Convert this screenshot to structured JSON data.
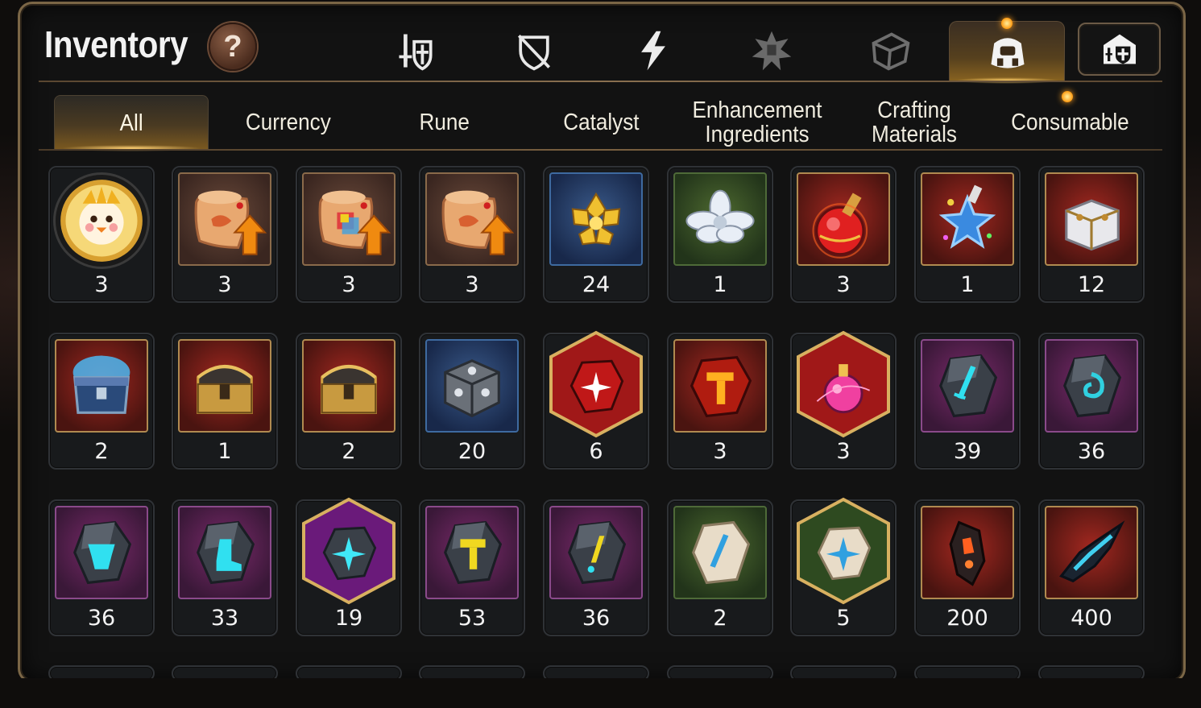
{
  "header": {
    "title": "Inventory",
    "help_label": "?"
  },
  "category_icons": [
    {
      "name": "equipment-icon",
      "active": false
    },
    {
      "name": "no-equip-icon",
      "active": false
    },
    {
      "name": "lightning-icon",
      "active": false
    },
    {
      "name": "artifact-icon",
      "active": false
    },
    {
      "name": "cube-icon",
      "active": false
    },
    {
      "name": "backpack-icon",
      "active": true
    },
    {
      "name": "guild-storage-icon",
      "active": false
    }
  ],
  "tabs": [
    {
      "label": "All",
      "active": true
    },
    {
      "label": "Currency",
      "active": false
    },
    {
      "label": "Rune",
      "active": false
    },
    {
      "label": "Catalyst",
      "active": false
    },
    {
      "label": "Enhancement Ingredients",
      "active": false
    },
    {
      "label": "Crafting Materials",
      "active": false
    },
    {
      "label": "Consumable",
      "active": false
    }
  ],
  "items": [
    {
      "count": "3",
      "icon": "mascot-coin-icon"
    },
    {
      "count": "3",
      "icon": "upgrade-scroll-icon"
    },
    {
      "count": "3",
      "icon": "rainbow-upgrade-scroll-icon"
    },
    {
      "count": "3",
      "icon": "upgrade-scroll-icon"
    },
    {
      "count": "24",
      "icon": "gold-crystal-icon"
    },
    {
      "count": "1",
      "icon": "silver-flower-icon"
    },
    {
      "count": "3",
      "icon": "red-potion-icon"
    },
    {
      "count": "1",
      "icon": "star-potion-icon"
    },
    {
      "count": "12",
      "icon": "silver-chest-icon"
    },
    {
      "count": "2",
      "icon": "blue-chest-icon"
    },
    {
      "count": "1",
      "icon": "gold-chest-icon"
    },
    {
      "count": "2",
      "icon": "gold-chest-icon"
    },
    {
      "count": "20",
      "icon": "steel-cube-icon"
    },
    {
      "count": "6",
      "icon": "red-star-stone-icon"
    },
    {
      "count": "3",
      "icon": "red-hammer-stone-icon"
    },
    {
      "count": "3",
      "icon": "pink-potion-icon"
    },
    {
      "count": "39",
      "icon": "sword-stone-icon"
    },
    {
      "count": "36",
      "icon": "swirl-stone-icon"
    },
    {
      "count": "36",
      "icon": "armor-stone-icon"
    },
    {
      "count": "33",
      "icon": "boot-stone-icon"
    },
    {
      "count": "19",
      "icon": "purple-star-stone-icon"
    },
    {
      "count": "53",
      "icon": "hammer-stone-icon"
    },
    {
      "count": "36",
      "icon": "exclaim-stone-icon"
    },
    {
      "count": "2",
      "icon": "white-sword-stone-icon"
    },
    {
      "count": "5",
      "icon": "white-star-stone-icon"
    },
    {
      "count": "200",
      "icon": "dark-crystal-icon"
    },
    {
      "count": "400",
      "icon": "dark-shard-icon"
    }
  ],
  "colors": {
    "accent_gold": "#f0a020",
    "frame_brown": "#7b6646",
    "text": "#f4f4f4"
  }
}
